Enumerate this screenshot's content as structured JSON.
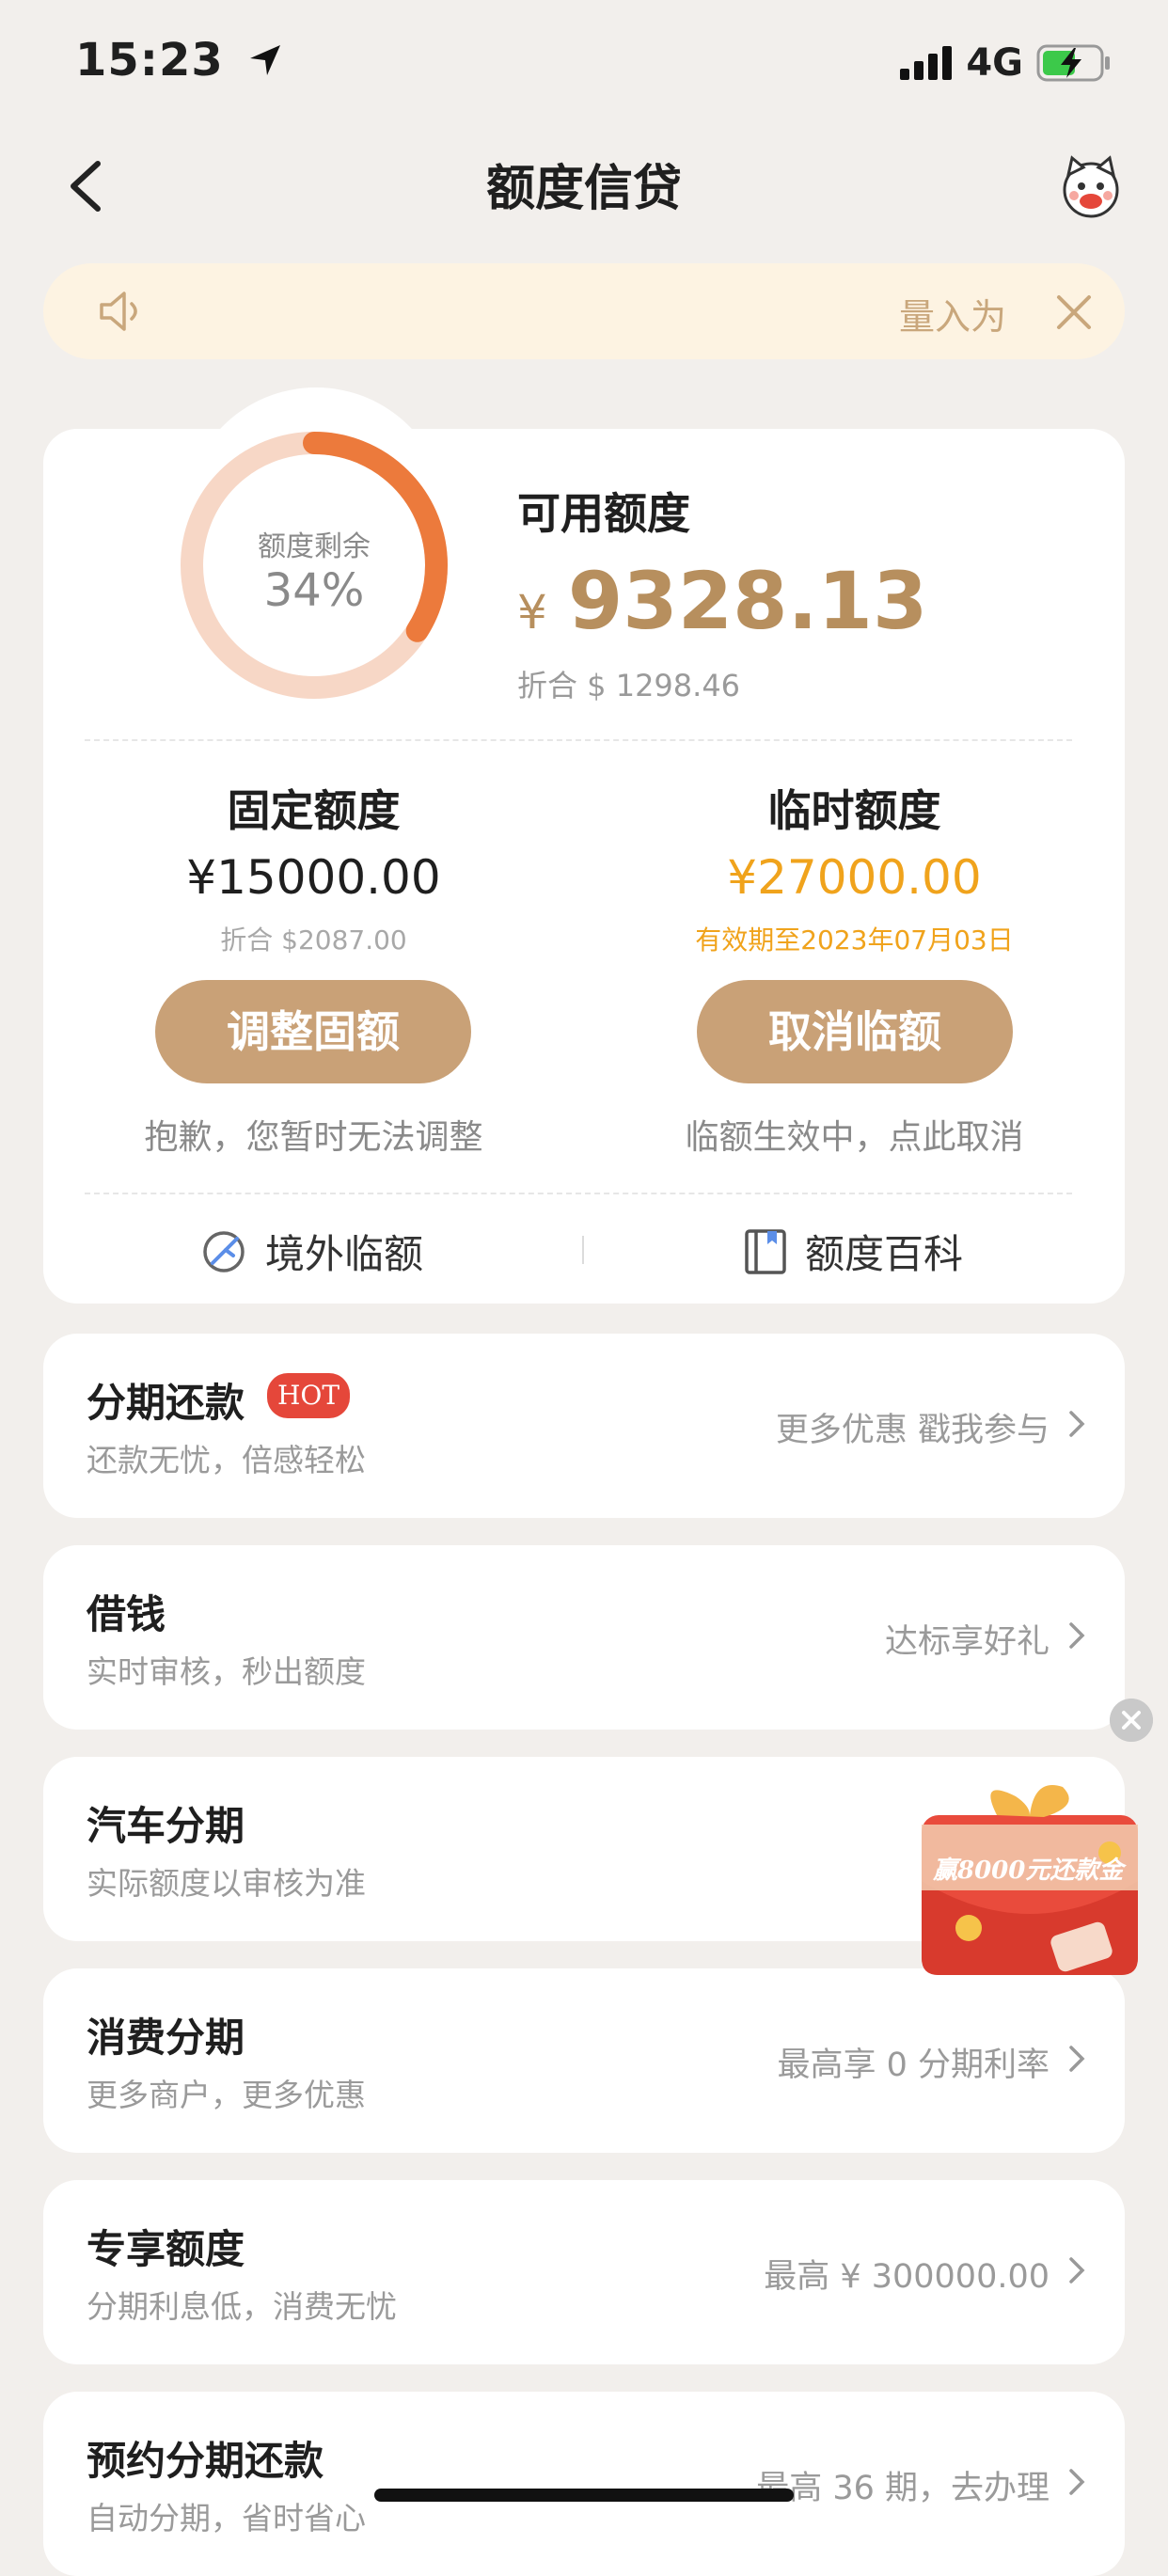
{
  "status_bar": {
    "time": "15:23",
    "network": "4G"
  },
  "nav": {
    "title": "额度信贷"
  },
  "notice": {
    "text": "量入为"
  },
  "quota": {
    "ring_label": "额度剩余",
    "ring_percent": "34%",
    "ring_fraction": 0.34,
    "available_label": "可用额度",
    "available_currency": "¥",
    "available_amount": "9328.13",
    "available_usd": "折合 $ 1298.46",
    "fixed": {
      "title": "固定额度",
      "amount": "¥15000.00",
      "sub": "折合 $2087.00",
      "button": "调整固额",
      "note": "抱歉，您暂时无法调整"
    },
    "temp": {
      "title": "临时额度",
      "amount": "¥27000.00",
      "sub": "有效期至2023年07月03日",
      "button": "取消临额",
      "note": "临额生效中，点此取消"
    },
    "links": {
      "overseas": "境外临额",
      "encyclopedia": "额度百科"
    }
  },
  "rows": [
    {
      "title": "分期还款",
      "badge": "HOT",
      "sub": "还款无忧，倍感轻松",
      "right": "更多优惠 戳我参与"
    },
    {
      "title": "借钱",
      "sub": "实时审核，秒出额度",
      "right": "达标享好礼"
    },
    {
      "title": "汽车分期",
      "sub": "实际额度以审核为准",
      "right": ""
    },
    {
      "title": "消费分期",
      "sub": "更多商户，更多优惠",
      "right": "最高享 0 分期利率"
    },
    {
      "title": "专享额度",
      "sub": "分期利息低，消费无忧",
      "right": "最高 ¥ 300000.00"
    },
    {
      "title": "预约分期还款",
      "sub": "自动分期，省时省心",
      "right": "最高 36 期，去办理"
    }
  ],
  "promo": {
    "text": "赢8000元还款金"
  },
  "colors": {
    "gold": "#b78f5e",
    "accent_orange": "#ec7a3c",
    "button": "#c9a177",
    "hot": "#e5473a"
  }
}
